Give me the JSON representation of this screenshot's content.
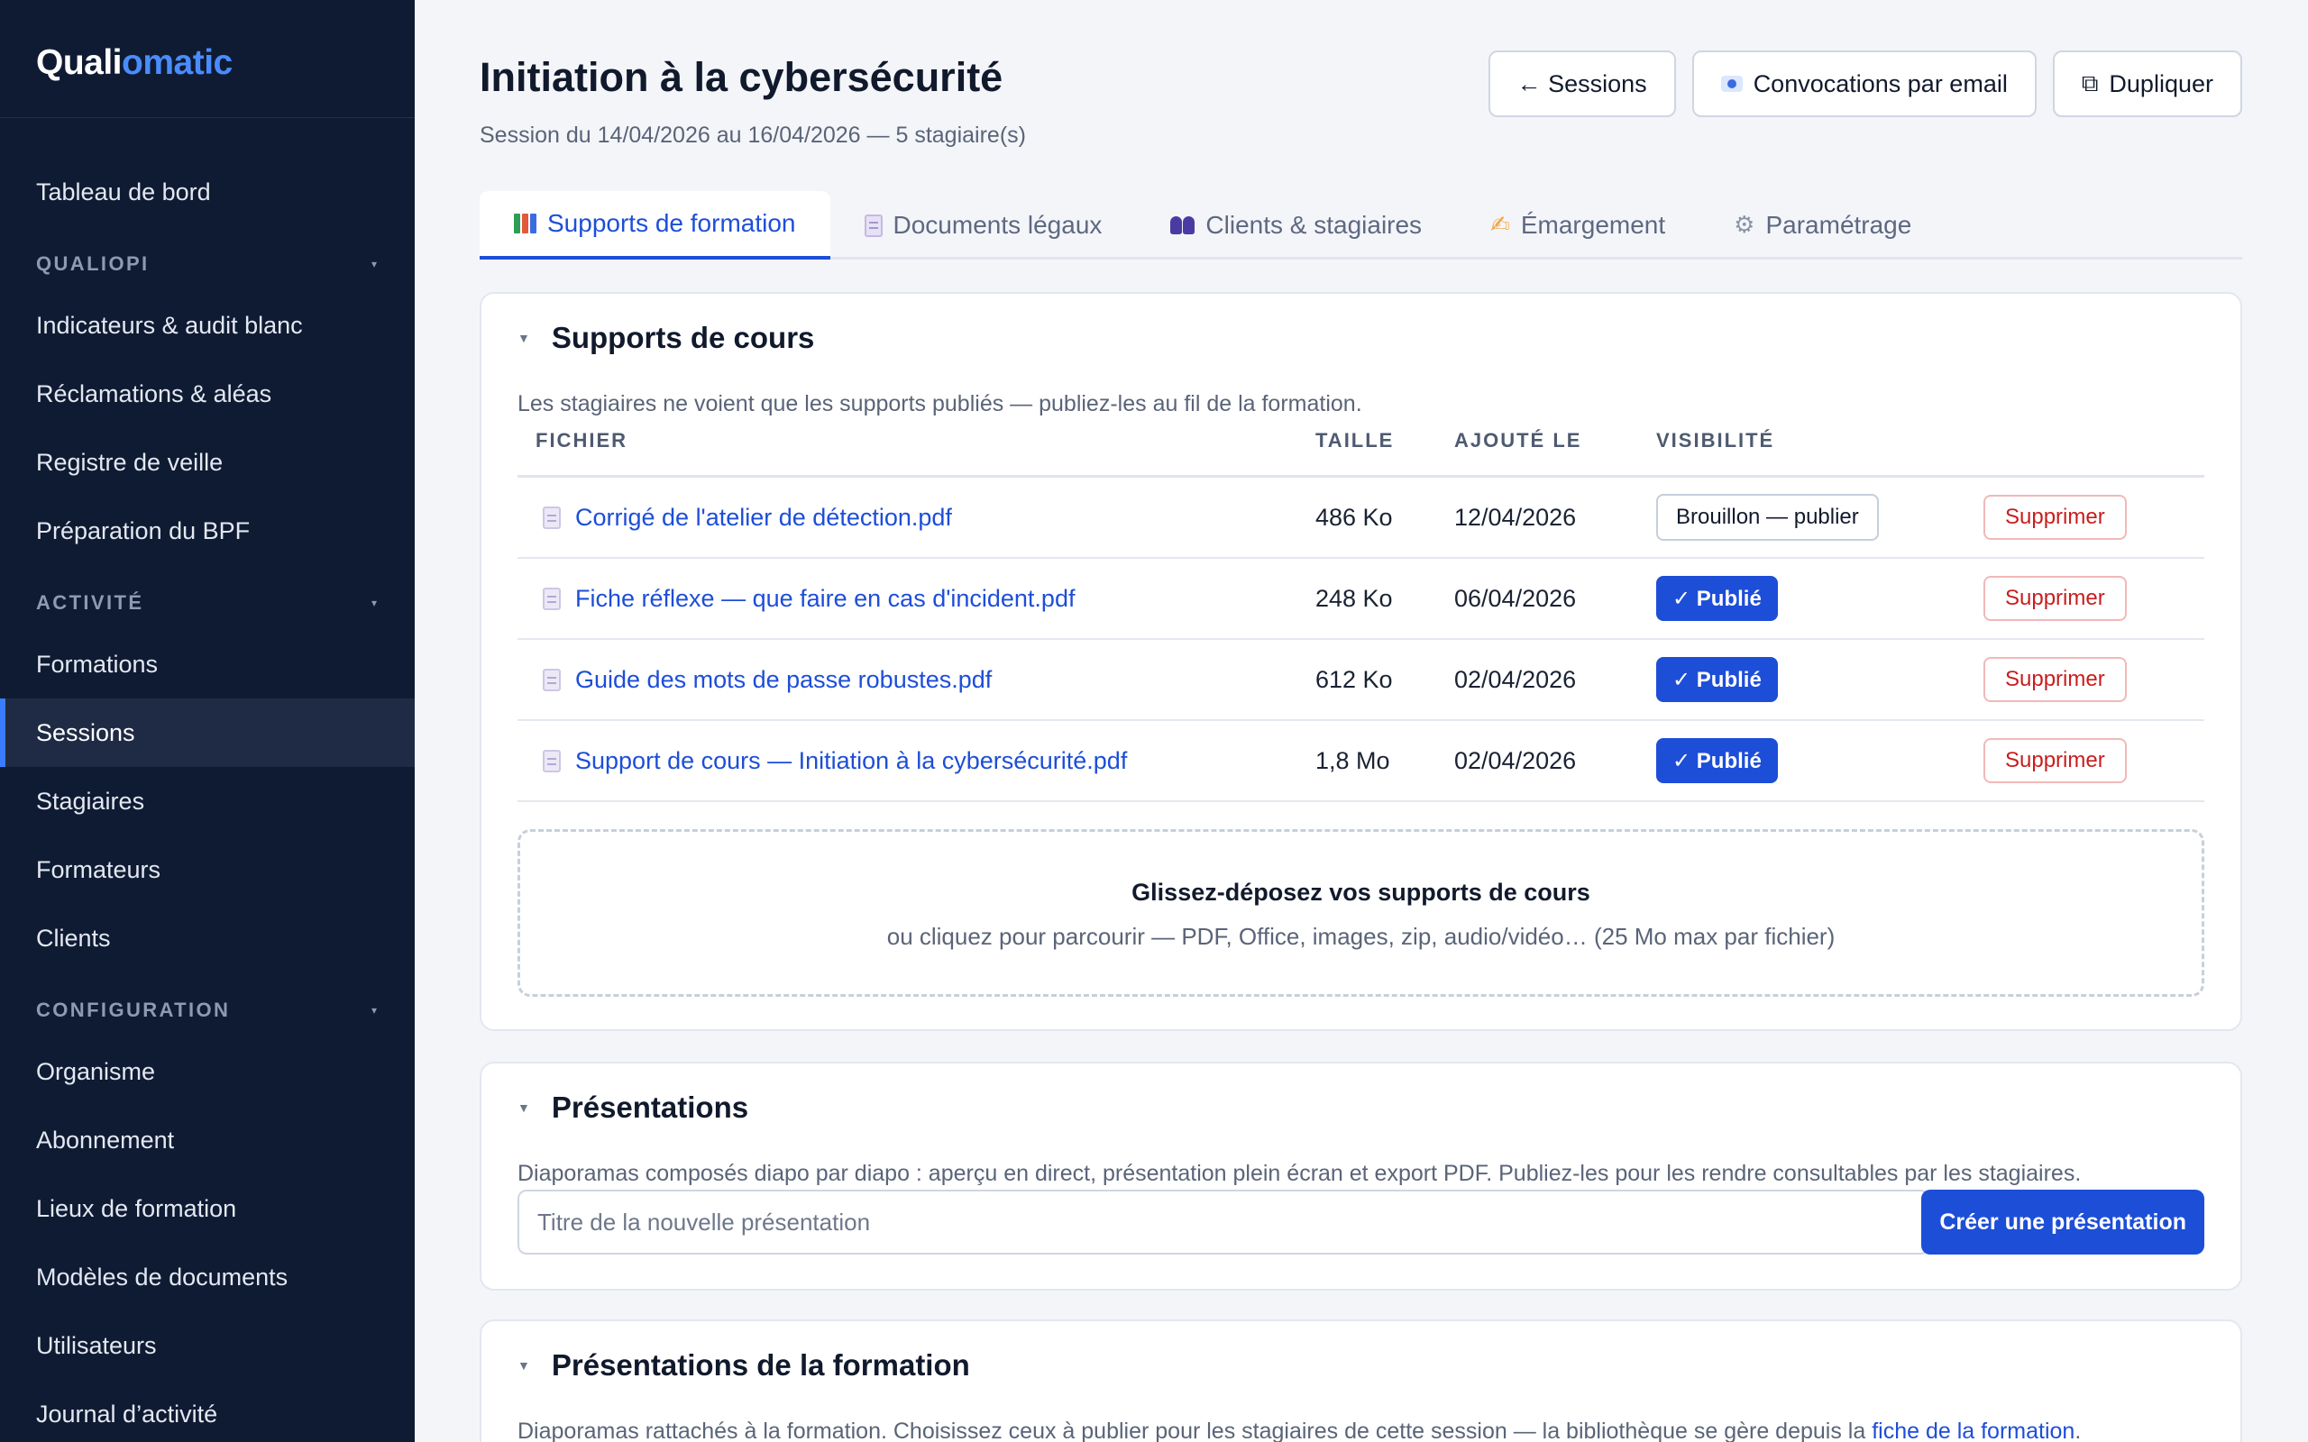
{
  "brand": {
    "part1": "Quali",
    "part2": "omatic"
  },
  "sidebar": {
    "top_item": "Tableau de bord",
    "sections": [
      {
        "title": "QUALIOPI",
        "items": [
          "Indicateurs & audit blanc",
          "Réclamations & aléas",
          "Registre de veille",
          "Préparation du BPF"
        ]
      },
      {
        "title": "ACTIVITÉ",
        "items": [
          "Formations",
          "Sessions",
          "Stagiaires",
          "Formateurs",
          "Clients"
        ]
      },
      {
        "title": "CONFIGURATION",
        "items": [
          "Organisme",
          "Abonnement",
          "Lieux de formation",
          "Modèles de documents",
          "Utilisateurs",
          "Journal d’activité"
        ]
      }
    ],
    "active_item": "Sessions"
  },
  "header": {
    "title": "Initiation à la cybersécurité",
    "subtitle": "Session du 14/04/2026 au 16/04/2026 — 5 stagiaire(s)",
    "back_label": "← Sessions",
    "convocations_label": "Convocations par email",
    "duplicate_label": "Dupliquer"
  },
  "tabs": [
    {
      "label": "Supports de formation",
      "icon": "books-icon",
      "active": true
    },
    {
      "label": "Documents légaux",
      "icon": "page-icon",
      "active": false
    },
    {
      "label": "Clients & stagiaires",
      "icon": "people-icon",
      "active": false
    },
    {
      "label": "Émargement",
      "icon": "writing-hand-icon",
      "active": false
    },
    {
      "label": "Paramétrage",
      "icon": "gear-icon",
      "active": false
    }
  ],
  "supports": {
    "title": "Supports de cours",
    "description": "Les stagiaires ne voient que les supports publiés — publiez-les au fil de la formation.",
    "columns": {
      "file": "FICHIER",
      "size": "TAILLE",
      "added": "AJOUTÉ LE",
      "visibility": "VISIBILITÉ"
    },
    "rows": [
      {
        "name": "Corrigé de l'atelier de détection.pdf",
        "size": "486 Ko",
        "date": "12/04/2026",
        "status": "Brouillon — publier",
        "published": false,
        "delete": "Supprimer"
      },
      {
        "name": "Fiche réflexe — que faire en cas d'incident.pdf",
        "size": "248 Ko",
        "date": "06/04/2026",
        "status": "✓ Publié",
        "published": true,
        "delete": "Supprimer"
      },
      {
        "name": "Guide des mots de passe robustes.pdf",
        "size": "612 Ko",
        "date": "02/04/2026",
        "status": "✓ Publié",
        "published": true,
        "delete": "Supprimer"
      },
      {
        "name": "Support de cours — Initiation à la cybersécurité.pdf",
        "size": "1,8 Mo",
        "date": "02/04/2026",
        "status": "✓ Publié",
        "published": true,
        "delete": "Supprimer"
      }
    ],
    "dropzone_title": "Glissez-déposez vos supports de cours",
    "dropzone_sub": "ou cliquez pour parcourir — PDF, Office, images, zip, audio/vidéo… (25 Mo max par fichier)"
  },
  "presentations": {
    "title": "Présentations",
    "description": "Diaporamas composés diapo par diapo : aperçu en direct, présentation plein écran et export PDF. Publiez-les pour les rendre consultables par les stagiaires.",
    "input_placeholder": "Titre de la nouvelle présentation",
    "create_label": "Créer une présentation"
  },
  "formation_presentations": {
    "title": "Présentations de la formation",
    "description_before": "Diaporamas rattachés à la formation. Choisissez ceux à publier pour les stagiaires de cette session — la bibliothèque se gère depuis la ",
    "link_label": "fiche de la formation",
    "description_after": "."
  },
  "colors": {
    "sidebar_bg": "#0f1b33",
    "accent": "#1d4ed8",
    "danger": "#c81e1e",
    "brand_accent": "#4a8cff"
  }
}
